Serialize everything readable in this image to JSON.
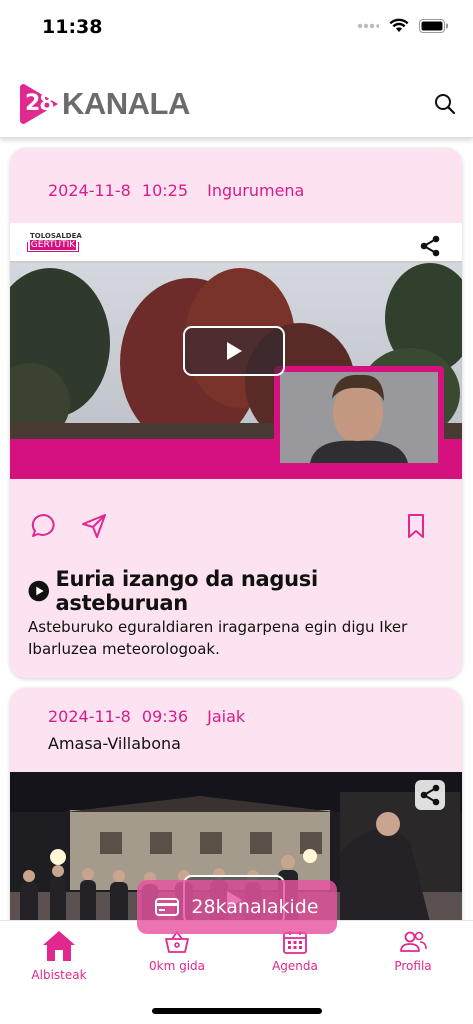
{
  "status_bar": {
    "time": "11:38"
  },
  "header": {
    "logo_badge": "28",
    "logo_text": "KANALA"
  },
  "colors": {
    "accent": "#e0288f",
    "card_bg": "#fde3f1",
    "meta": "#d81b8a"
  },
  "articles": [
    {
      "date": "2024-11-8",
      "time": "10:25",
      "category": "Ingurumena",
      "place": "",
      "video_brand_top": "TOLOSALDEA",
      "video_brand_bottom": "GERTUTIK",
      "title": "Euria izango da nagusi asteburuan",
      "summary": "Asteburuko eguraldiaren iragarpena egin digu Iker Ibarluzea meteorologoak."
    },
    {
      "date": "2024-11-8",
      "time": "09:36",
      "category": "Jaiak",
      "place": "Amasa-Villabona"
    }
  ],
  "member_button": {
    "label": "28kanalakide"
  },
  "bottom_nav": [
    {
      "label": "Albisteak",
      "icon": "home-icon",
      "active": true
    },
    {
      "label": "0km gida",
      "icon": "basket-icon",
      "active": false
    },
    {
      "label": "Agenda",
      "icon": "calendar-icon",
      "active": false
    },
    {
      "label": "Profila",
      "icon": "users-icon",
      "active": false
    }
  ]
}
